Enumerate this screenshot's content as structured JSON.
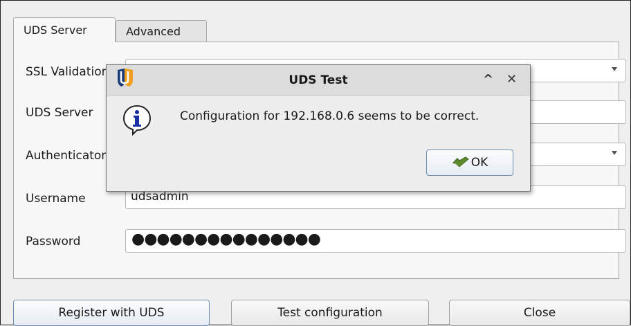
{
  "tabs": [
    {
      "label": "UDS Server",
      "active": true
    },
    {
      "label": "Advanced",
      "active": false
    }
  ],
  "form": {
    "ssl_label": "SSL Validation",
    "ssl_value": "",
    "server_label": "UDS Server",
    "server_value": "",
    "auth_label": "Authenticator",
    "auth_value": "",
    "username_label": "Username",
    "username_value": "udsadmin",
    "password_label": "Password",
    "password_mask": "●●●●●●●●●●●●●●●"
  },
  "buttons": {
    "register": "Register with UDS",
    "test": "Test configuration",
    "close": "Close"
  },
  "dialog": {
    "title": "UDS Test",
    "message": "Configuration for 192.168.0.6 seems to be correct.",
    "ok_label": "OK",
    "icons": [
      "uds-logo-icon",
      "info-icon",
      "ok-check-icon",
      "maximize-icon",
      "close-icon"
    ]
  },
  "colors": {
    "accent_border": "#6d8db5",
    "info_blue": "#1b2fa6"
  }
}
